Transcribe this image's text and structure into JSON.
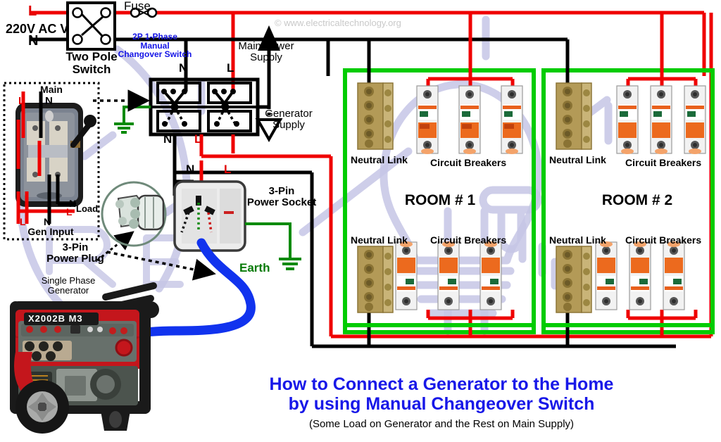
{
  "meta": {
    "watermark": "© www.electricaltechnology.org",
    "bg_watermark_shape": "lightbulb-hand-logo"
  },
  "colors": {
    "live_red": "#ef0000",
    "neutral_black": "#000000",
    "earth_green": "#068a06",
    "room_border_green": "#00cc00",
    "generator_cable_blue": "#1133ee",
    "title_blue": "#1818e8",
    "breaker_orange": "#ec6a1e",
    "neutral_link_brass": "#b49a56",
    "watermark_grey": "#c9c9c9",
    "bg_logo_purple": "#c3c3e4"
  },
  "supply": {
    "voltage_label": "220V AC V",
    "line_label": "L",
    "neutral_label": "N",
    "two_pole_switch": "Two Pole\nSwitch",
    "fuse_label": "Fuse"
  },
  "changeover": {
    "name": "2P 1-Phase\nManual\nChangover Switch",
    "top_neutral": "N",
    "top_line": "L",
    "bottom_neutral": "N",
    "bottom_line": "L",
    "main_power_supply": "Main Power\nSupply",
    "generator_supply": "Generator\nSupply"
  },
  "photo_panel": {
    "main_label": "Main",
    "main_l": "L",
    "main_n": "N",
    "load_n": "N",
    "load_label": "Load",
    "gen_l": "L",
    "gen_n": "N",
    "gen_input_label": "Gen Input"
  },
  "socket": {
    "title": "3-Pin\nPower Socket",
    "feed_n": "N",
    "feed_l": "L",
    "earth_label": "Earth"
  },
  "plug": {
    "title": "3-Pin\nPower Plug"
  },
  "generator": {
    "title": "Single Phase\nGenerator",
    "model_text": "X2002B M3"
  },
  "rooms": [
    {
      "name": "ROOM # 1",
      "upper": {
        "neutral_link": "Neutral Link",
        "breakers": "Circuit Breakers",
        "breaker_count": 3
      },
      "lower": {
        "neutral_link": "Neutral Link",
        "breakers": "Circuit Breakers",
        "breaker_count": 3
      }
    },
    {
      "name": "ROOM # 2",
      "upper": {
        "neutral_link": "Neutral Link",
        "breakers": "Circuit Breakers",
        "breaker_count": 3
      },
      "lower": {
        "neutral_link": "Neutral Link",
        "breakers": "Circuit Breakers",
        "breaker_count": 3
      }
    }
  ],
  "title": {
    "line1": "How to Connect a Generator to the Home",
    "line2": "by using Manual Changeover Switch",
    "line3": "(Some Load on Generator and the Rest on Main Supply)"
  }
}
